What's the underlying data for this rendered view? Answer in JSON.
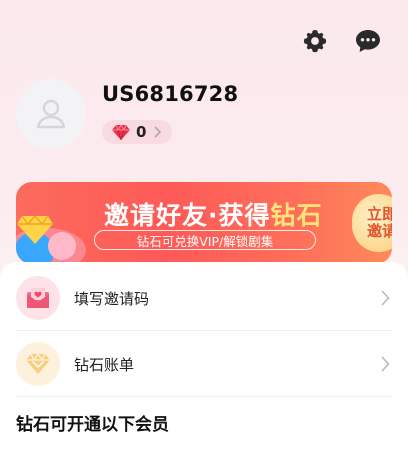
{
  "header": {
    "settings_icon": "gear-icon",
    "messages_icon": "chat-bubble-icon"
  },
  "profile": {
    "avatar_icon": "user-icon",
    "user_id": "US6816728",
    "diamond_count": "0"
  },
  "banner": {
    "title_part1": "邀请好友·获得",
    "title_highlight": "钻石",
    "subtitle": "钻石可兑换VIP/解锁剧集",
    "cta_line1": "立即",
    "cta_line2": "邀请",
    "colors": {
      "background": "#fd5a57",
      "highlight": "#ffe27a",
      "cta": "#fbd88f"
    }
  },
  "menu": {
    "items": [
      {
        "label": "填写邀请码",
        "icon": "envelope-icon",
        "icon_bg": "#fde3e8"
      },
      {
        "label": "钻石账单",
        "icon": "diamond-icon",
        "icon_bg": "#fdf1dd"
      }
    ]
  },
  "section": {
    "title": "钻石可开通以下会员"
  }
}
